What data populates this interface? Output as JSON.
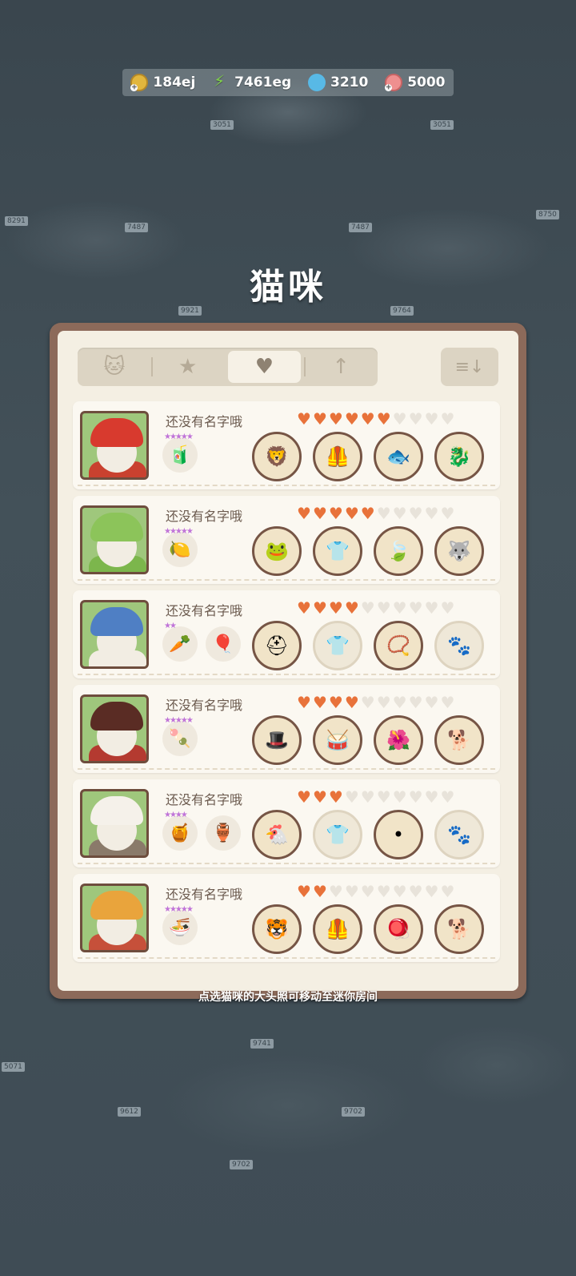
{
  "hud": {
    "coins": "184ej",
    "energy": "7461eg",
    "gems": "3210",
    "fish": "5000"
  },
  "page_title": "猫咪",
  "tabs": [
    {
      "icon": "cat-icon",
      "glyph": "🐱"
    },
    {
      "icon": "star-icon",
      "glyph": "★"
    },
    {
      "icon": "heart-icon",
      "glyph": "♥"
    },
    {
      "icon": "arrow-up-icon",
      "glyph": "↑"
    }
  ],
  "active_tab": 2,
  "sort_glyph": "≡↓",
  "cats": [
    {
      "name": "还没有名字哦",
      "hearts": 6,
      "max_hearts": 10,
      "theme": "lion-dance",
      "favs": [
        {
          "icon": "juice-bottle-icon",
          "glyph": "🧃",
          "stars": 5
        }
      ],
      "items": [
        {
          "icon": "lion-dance-hat-icon",
          "glyph": "🦁"
        },
        {
          "icon": "red-vest-icon",
          "glyph": "🦺"
        },
        {
          "icon": "koi-fish-icon",
          "glyph": "🐟"
        },
        {
          "icon": "dragon-plush-icon",
          "glyph": "🐉"
        }
      ]
    },
    {
      "name": "还没有名字哦",
      "hearts": 5,
      "max_hearts": 10,
      "theme": "frog",
      "favs": [
        {
          "icon": "lemon-slice-icon",
          "glyph": "🍋",
          "stars": 5
        }
      ],
      "items": [
        {
          "icon": "frog-hat-icon",
          "glyph": "🐸"
        },
        {
          "icon": "frog-suit-icon",
          "glyph": "👕"
        },
        {
          "icon": "lily-pad-icon",
          "glyph": "🍃"
        },
        {
          "icon": "husky-plush-icon",
          "glyph": "🐺"
        }
      ]
    },
    {
      "name": "还没有名字哦",
      "hearts": 4,
      "max_hearts": 10,
      "theme": "helmet",
      "favs": [
        {
          "icon": "carrot-icon",
          "glyph": "🥕",
          "stars": 2
        },
        {
          "icon": "hot-air-balloon-icon",
          "glyph": "🎈",
          "stars": 0
        }
      ],
      "items": [
        {
          "icon": "blue-helmet-icon",
          "glyph": "⛑"
        },
        {
          "icon": "empty-shirt-slot-icon",
          "glyph": "👕",
          "empty": true
        },
        {
          "icon": "collar-icon",
          "glyph": "📿"
        },
        {
          "icon": "empty-pet-slot-icon",
          "glyph": "🐾",
          "empty": true
        }
      ]
    },
    {
      "name": "还没有名字哦",
      "hearts": 4,
      "max_hearts": 10,
      "theme": "official",
      "favs": [
        {
          "icon": "skewer-icon",
          "glyph": "🍡",
          "stars": 5
        }
      ],
      "items": [
        {
          "icon": "official-hat-icon",
          "glyph": "🎩"
        },
        {
          "icon": "drum-icon",
          "glyph": "🥁"
        },
        {
          "icon": "red-flower-icon",
          "glyph": "🌺"
        },
        {
          "icon": "shiba-plush-icon",
          "glyph": "🐕"
        }
      ]
    },
    {
      "name": "还没有名字哦",
      "hearts": 3,
      "max_hearts": 10,
      "theme": "chicken",
      "favs": [
        {
          "icon": "honeycomb-icon",
          "glyph": "🍯",
          "stars": 4
        },
        {
          "icon": "jar-icon",
          "glyph": "🏺",
          "stars": 0
        }
      ],
      "items": [
        {
          "icon": "chicken-hood-icon",
          "glyph": "🐔"
        },
        {
          "icon": "empty-shirt-slot-icon",
          "glyph": "👕",
          "empty": true
        },
        {
          "icon": "bead-icon",
          "glyph": "•"
        },
        {
          "icon": "empty-pet-slot-icon",
          "glyph": "🐾",
          "empty": true
        }
      ]
    },
    {
      "name": "还没有名字哦",
      "hearts": 2,
      "max_hearts": 10,
      "theme": "tiger",
      "favs": [
        {
          "icon": "noodle-bowl-icon",
          "glyph": "🍜",
          "stars": 5
        }
      ],
      "items": [
        {
          "icon": "tiger-hat-icon",
          "glyph": "🐯"
        },
        {
          "icon": "tiger-vest-icon",
          "glyph": "🦺"
        },
        {
          "icon": "rattle-icon",
          "glyph": "🪀"
        },
        {
          "icon": "shiba-plush-icon",
          "glyph": "🐕"
        }
      ]
    }
  ],
  "hint": "点选猫咪的大头照可移动至迷你房间",
  "colors": {
    "heart_on": "#e8723a",
    "frame": "#8c6a5a",
    "panel": "#f4efe3"
  }
}
